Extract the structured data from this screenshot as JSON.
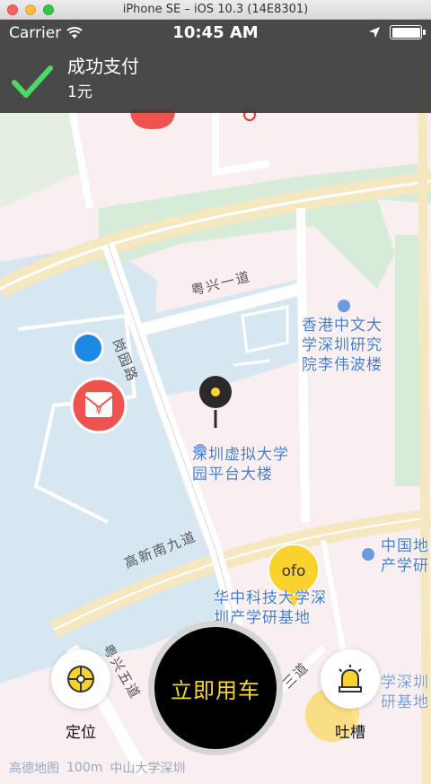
{
  "simulator": {
    "title": "iPhone SE – iOS 10.3 (14E8301)"
  },
  "status_bar": {
    "carrier": "Carrier",
    "time": "10:45 AM"
  },
  "banner": {
    "title": "成功支付",
    "amount": "1元"
  },
  "map": {
    "pois": [
      {
        "name": "香港中文大学深圳研究院李伟波楼",
        "lines": [
          "香港中文大",
          "学深圳研究",
          "院李伟波楼"
        ]
      },
      {
        "name": "深圳虚拟大学园平台大楼",
        "lines": [
          "深圳虚拟大学",
          "园平台大楼"
        ]
      },
      {
        "name": "华中科技大学深圳产学研基地",
        "lines": [
          "华中科技大学深",
          "圳产学研基地"
        ]
      },
      {
        "name": "中国地产学研",
        "lines": [
          "中国地",
          "产学研"
        ]
      },
      {
        "name": "学深圳研基地",
        "lines": [
          "学深圳",
          "研基地"
        ]
      }
    ],
    "roads": [
      "粤兴一道",
      "岗园路",
      "高新南九道",
      "粤兴五道",
      "三道"
    ],
    "markers": {
      "ofo_label": "ofo"
    },
    "attribution": {
      "provider": "高德地图",
      "scale": "100m",
      "place": "中山大学深圳"
    }
  },
  "controls": {
    "locate_label": "定位",
    "ride_label": "立即用车",
    "feedback_label": "吐槽"
  },
  "colors": {
    "map_bg": "#f9eef0",
    "water": "#d7e7f1",
    "green": "#d6ecd9",
    "ride_text": "#f8d52c",
    "ofo_yellow": "#f9d22e",
    "redpacket": "#ef5350",
    "location_blue": "#1e88e5"
  }
}
